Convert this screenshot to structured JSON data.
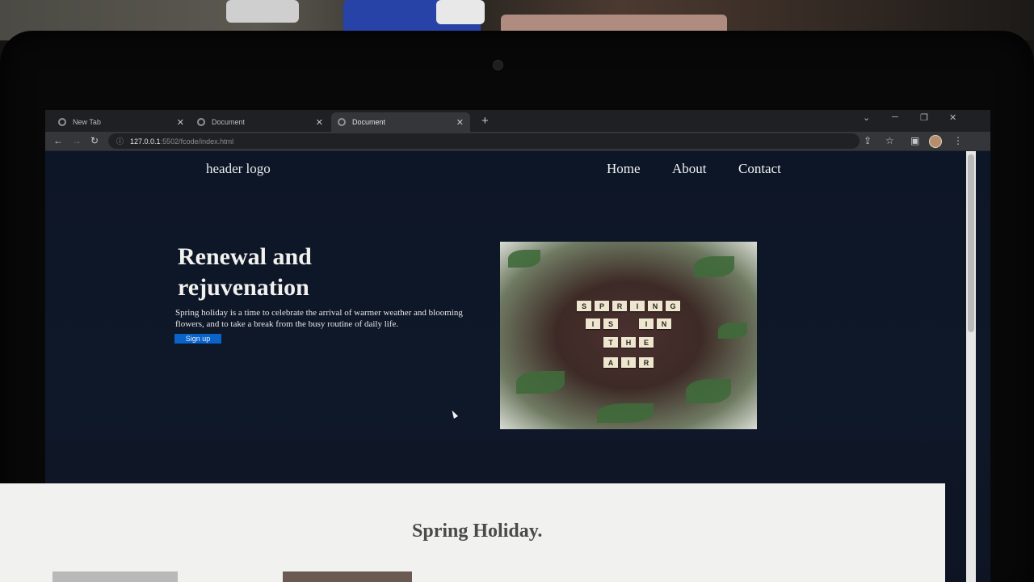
{
  "browser": {
    "tabs": [
      {
        "title": "New Tab",
        "active": false
      },
      {
        "title": "Document",
        "active": false
      },
      {
        "title": "Document",
        "active": true
      }
    ],
    "new_tab_symbol": "+",
    "close_symbol": "✕",
    "url_host": "127.0.0.1",
    "url_path": ":5502/fcode/index.html",
    "icons": [
      "back-arrow-icon",
      "forward-arrow-icon",
      "reload-icon",
      "info-icon",
      "share-icon",
      "star-icon",
      "sidebar-icon",
      "profile-avatar",
      "kebab-menu-icon"
    ]
  },
  "site": {
    "logo": "header logo",
    "nav": [
      "Home",
      "About",
      "Contact"
    ],
    "hero": {
      "title": "Renewal and rejuvenation",
      "text": "Spring holiday is a time to celebrate the arrival of warmer weather and blooming flowers, and to take a break from the busy routine of daily life.",
      "button": "Sign up",
      "image_tiles": [
        "SPRING",
        "IS IN",
        "THE",
        "AIR"
      ]
    },
    "section_title": "Spring Holiday.",
    "colors": {
      "hero_bg": "#0e1624",
      "button": "#0a63c9",
      "section_bg": "#f1f1ef"
    }
  }
}
